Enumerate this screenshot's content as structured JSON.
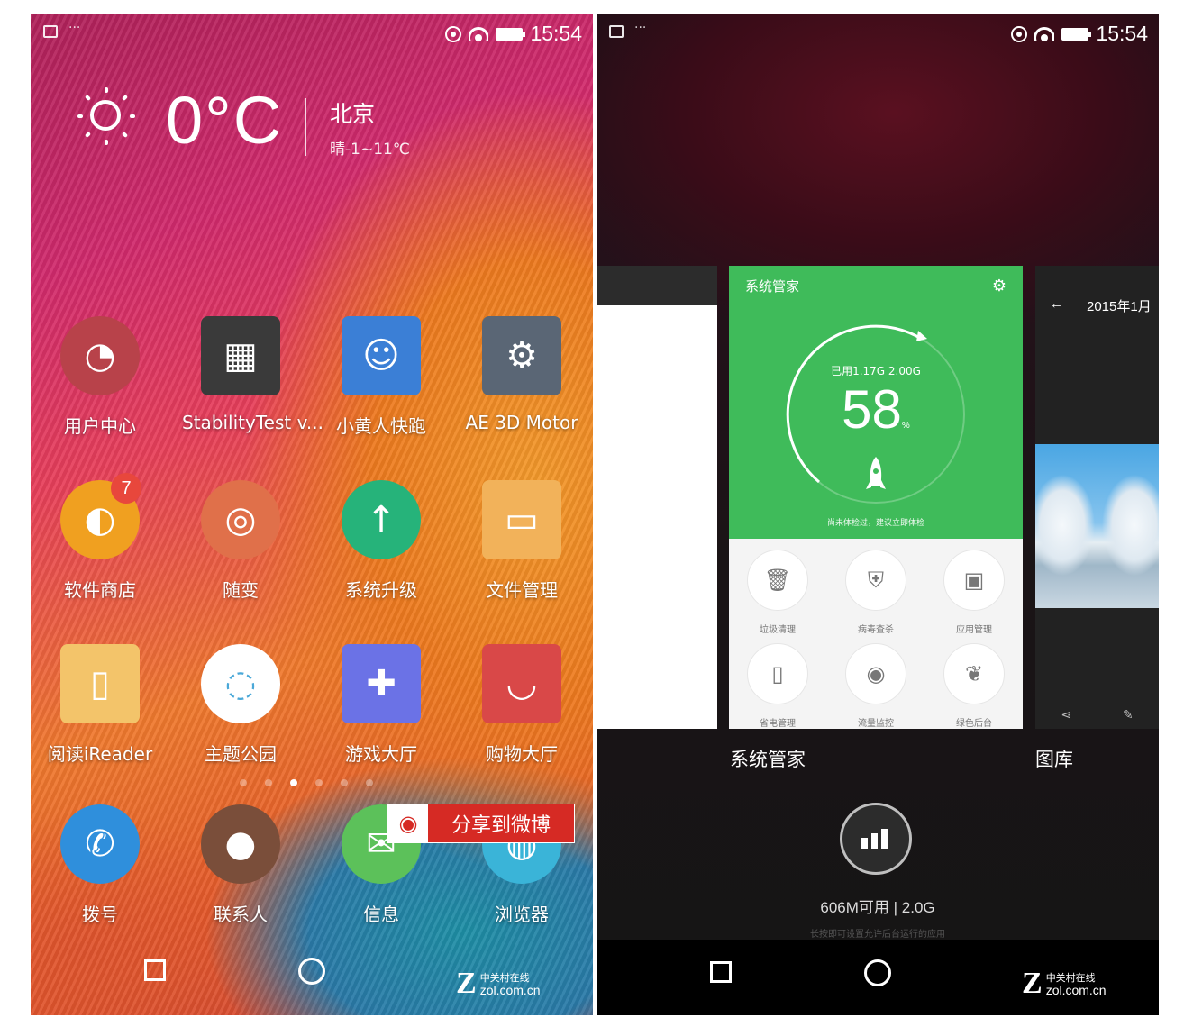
{
  "left_screen": {
    "status": {
      "dots": "···",
      "time": "15:54"
    },
    "weather": {
      "temp": "0°C",
      "city": "北京",
      "desc": "晴-1~11℃"
    },
    "apps": [
      {
        "label": "用户中心",
        "icon": "user-center-icon",
        "color": "#b8424a"
      },
      {
        "label": "StabilityTest v...",
        "icon": "stability-test-icon",
        "color": "#3a3a3a"
      },
      {
        "label": "小黄人快跑",
        "icon": "minion-rush-icon",
        "color": "#3b7fd6"
      },
      {
        "label": "AE 3D Motor",
        "icon": "ae-3d-motor-icon",
        "color": "#5a6675"
      },
      {
        "label": "软件商店",
        "icon": "app-store-icon",
        "color": "#f0a020",
        "badge": "7"
      },
      {
        "label": "随变",
        "icon": "chameleon-icon",
        "color": "#e0704a"
      },
      {
        "label": "系统升级",
        "icon": "system-update-icon",
        "color": "#26b37a"
      },
      {
        "label": "文件管理",
        "icon": "file-manager-icon",
        "color": "#f2b25a"
      },
      {
        "label": "阅读iReader",
        "icon": "ireader-icon",
        "color": "#f3c46a"
      },
      {
        "label": "主题公园",
        "icon": "theme-park-icon",
        "color": "#ffffff"
      },
      {
        "label": "游戏大厅",
        "icon": "game-hall-icon",
        "color": "#6b72e6"
      },
      {
        "label": "购物大厅",
        "icon": "shopping-hall-icon",
        "color": "#d94848"
      }
    ],
    "dock": [
      {
        "label": "拨号",
        "icon": "phone-icon",
        "color": "#2f8fdc"
      },
      {
        "label": "联系人",
        "icon": "contacts-icon",
        "color": "#7a4e3a"
      },
      {
        "label": "信息",
        "icon": "message-icon",
        "color": "#5cc15a"
      },
      {
        "label": "浏览器",
        "icon": "browser-icon",
        "color": "#3ab4d8"
      }
    ],
    "share_label": "分享到微博",
    "watermark": {
      "line1": "中关村在线",
      "line2": "zol.com.cn"
    }
  },
  "right_screen": {
    "status": {
      "dots": "···",
      "time": "15:54"
    },
    "main_card": {
      "title": "系统管家",
      "used": "已用1.17G  2.00G",
      "percent": "58",
      "percent_unit": "%",
      "tip": "尚未体检过，建议立即体检",
      "tools": [
        {
          "label": "垃圾清理",
          "icon": "trash-icon"
        },
        {
          "label": "病毒查杀",
          "icon": "shield-icon"
        },
        {
          "label": "应用管理",
          "icon": "android-icon"
        },
        {
          "label": "省电管理",
          "icon": "battery-icon"
        },
        {
          "label": "流量监控",
          "icon": "traffic-icon"
        },
        {
          "label": "绿色后台",
          "icon": "leaf-icon"
        }
      ],
      "label": "系统管家"
    },
    "gallery_card": {
      "header": "2015年1月",
      "label": "图库"
    },
    "memory": {
      "text": "606M可用 | 2.0G",
      "hint": "长按即可设置允许后台运行的应用"
    },
    "watermark": {
      "line1": "中关村在线",
      "line2": "zol.com.cn"
    }
  }
}
